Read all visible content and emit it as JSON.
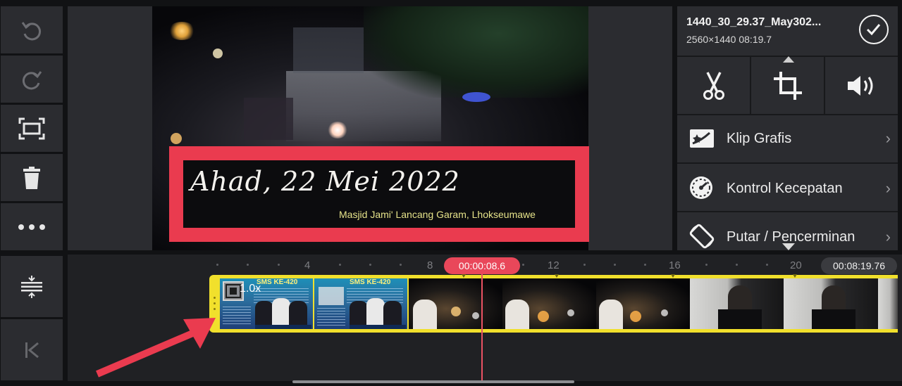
{
  "toolbar_left": {
    "undo_icon": "undo-icon",
    "redo_icon": "redo-icon",
    "fit_icon": "fit-screen-icon",
    "delete_icon": "trash-icon",
    "more_icon": "more-dots-icon",
    "track_icon": "track-height-icon",
    "jump_start_icon": "jump-to-start-icon"
  },
  "preview": {
    "title_text": "Ahad, 22 Mei 2022",
    "subtitle_text": "Masjid Jami' Lancang Garam, Lhokseumawe"
  },
  "clip_info": {
    "filename": "1440_30_29.37_May302...",
    "meta": "2560×1440  08:19.7"
  },
  "tools": [
    {
      "icon": "scissors-icon"
    },
    {
      "icon": "crop-icon"
    },
    {
      "icon": "volume-icon"
    }
  ],
  "menu": [
    {
      "label": "Klip Grafis",
      "icon": "graphic-clip-icon"
    },
    {
      "label": "Kontrol Kecepatan",
      "icon": "speedometer-icon"
    },
    {
      "label": "Putar / Pencerminan",
      "icon": "rotate-icon"
    }
  ],
  "timeline": {
    "playhead_time": "00:00:08.6",
    "total_time": "00:08:19.76",
    "ticks": [
      "4",
      "8",
      "12",
      "16",
      "20"
    ],
    "clip_speed_label": "1.0x",
    "poster_heading": "SMS KE-420"
  },
  "colors": {
    "accent_red": "#ea3b4f",
    "clip_border": "#f1e02c",
    "panel": "#2b2c30"
  }
}
